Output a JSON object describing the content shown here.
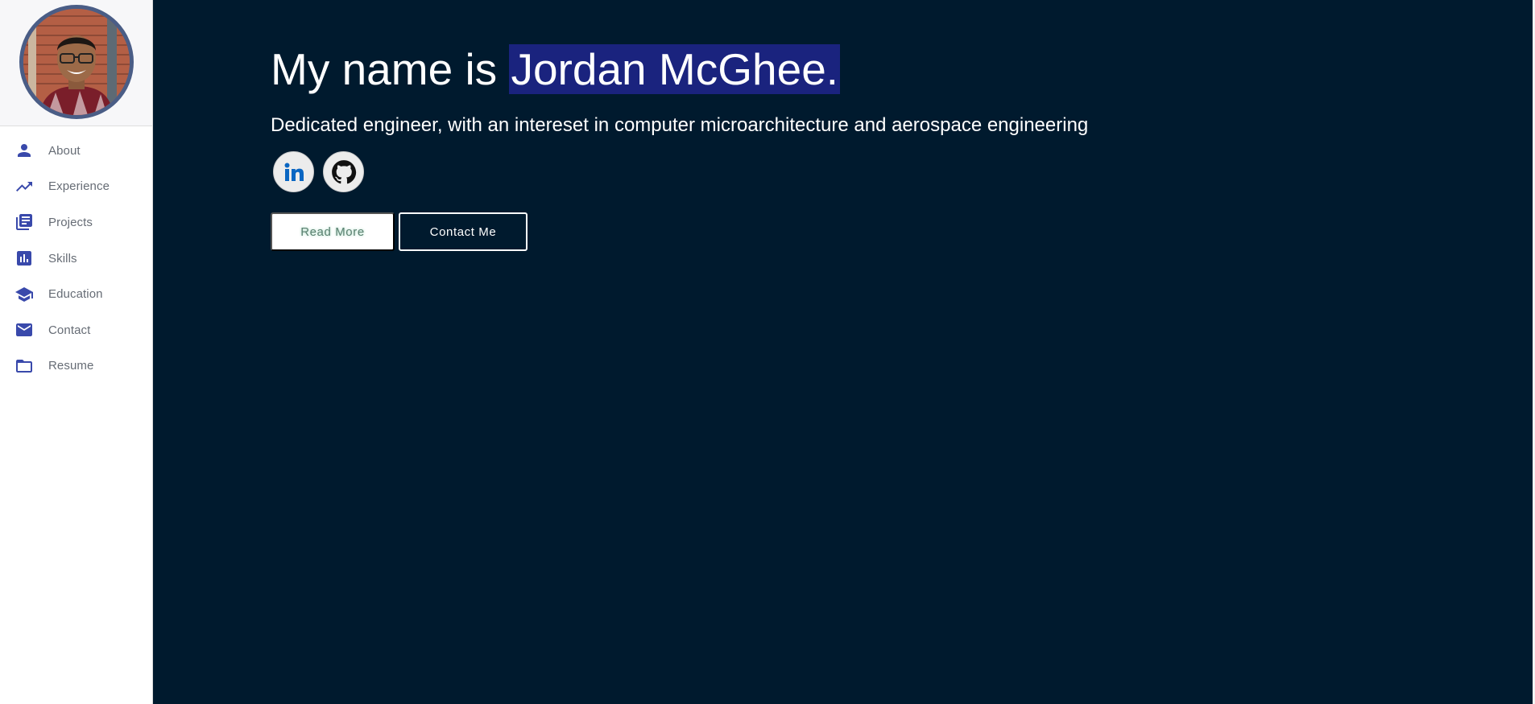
{
  "sidebar": {
    "avatar_alt": "Jordan McGhee profile photo",
    "items": [
      {
        "label": "About",
        "icon": "person-icon"
      },
      {
        "label": "Experience",
        "icon": "trending-up-icon"
      },
      {
        "label": "Projects",
        "icon": "library-books-icon"
      },
      {
        "label": "Skills",
        "icon": "bar-chart-icon"
      },
      {
        "label": "Education",
        "icon": "school-icon"
      },
      {
        "label": "Contact",
        "icon": "mail-icon"
      },
      {
        "label": "Resume",
        "icon": "folder-icon"
      }
    ]
  },
  "hero": {
    "title_prefix": "My name is ",
    "title_name": "Jordan McGhee.",
    "subtitle": "Dedicated engineer, with an intereset in computer microarchitecture and aerospace engineering",
    "socials": [
      {
        "icon": "linkedin-icon"
      },
      {
        "icon": "github-icon"
      }
    ],
    "read_more_label": "Read More",
    "contact_label": "Contact Me"
  },
  "colors": {
    "background": "#001a2e",
    "accent": "#3949ab",
    "highlight": "#1a237e"
  }
}
